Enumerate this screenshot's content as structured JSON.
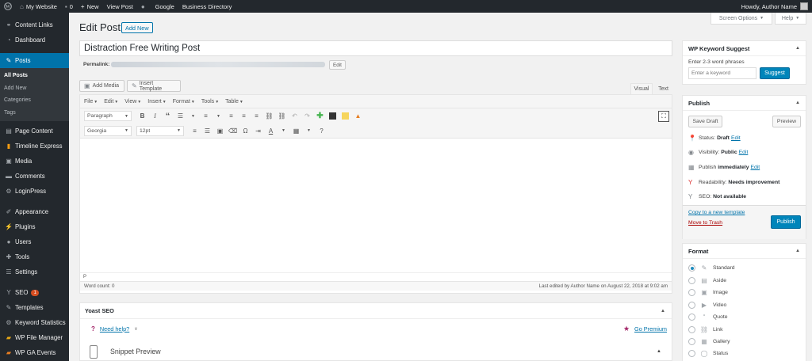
{
  "admin_bar": {
    "site_name": "My Website",
    "comments_count": "0",
    "new_label": "New",
    "view_post_label": "View Post",
    "google_label": "Google",
    "business_directory_label": "Business Directory",
    "howdy": "Howdy, Author Name"
  },
  "sidebar": {
    "items": [
      {
        "label": "Content Links",
        "icon": "link-icon"
      },
      {
        "label": "Dashboard",
        "icon": "dashboard-icon"
      },
      {
        "label": "Posts",
        "icon": "pushpin-icon"
      },
      {
        "label": "Page Content",
        "icon": "page-icon"
      },
      {
        "label": "Timeline Express",
        "icon": "timeline-icon"
      },
      {
        "label": "Media",
        "icon": "media-icon"
      },
      {
        "label": "Comments",
        "icon": "comment-icon"
      },
      {
        "label": "LoginPress",
        "icon": "login-icon"
      },
      {
        "label": "Appearance",
        "icon": "brush-icon"
      },
      {
        "label": "Plugins",
        "icon": "plugin-icon"
      },
      {
        "label": "Users",
        "icon": "user-icon"
      },
      {
        "label": "Tools",
        "icon": "wrench-icon"
      },
      {
        "label": "Settings",
        "icon": "settings-icon"
      },
      {
        "label": "SEO",
        "icon": "yoast-icon",
        "badge": "1"
      },
      {
        "label": "Templates",
        "icon": "template-icon"
      },
      {
        "label": "Keyword Statistics",
        "icon": "stats-icon"
      },
      {
        "label": "WP File Manager",
        "icon": "folder-icon"
      },
      {
        "label": "WP GA Events",
        "icon": "events-icon"
      }
    ],
    "posts_submenu": [
      "All Posts",
      "Add New",
      "Categories",
      "Tags"
    ]
  },
  "screen_options": "Screen Options",
  "help": "Help",
  "page": {
    "title": "Edit Post",
    "add_new": "Add New",
    "post_title": "Distraction Free Writing Post",
    "permalink_label": "Permalink:",
    "permalink_edit": "Edit"
  },
  "media_buttons": {
    "add_media": "Add Media",
    "insert_template": "Insert Template"
  },
  "editor": {
    "tab_visual": "Visual",
    "tab_text": "Text",
    "menus": [
      "File",
      "Edit",
      "View",
      "Insert",
      "Format",
      "Tools",
      "Table"
    ],
    "format_select": "Paragraph",
    "font_select": "Georgia",
    "size_select": "12pt",
    "path": "P",
    "word_count": "Word count: 0",
    "last_edited": "Last edited by Author Name on August 22, 2018 at 9:02 am"
  },
  "yoast": {
    "title": "Yoast SEO",
    "need_help": "Need help?",
    "go_premium": "Go Premium",
    "snippet_preview": "Snippet Preview"
  },
  "keyword_box": {
    "title": "WP Keyword Suggest",
    "label": "Enter 2-3 word phrases",
    "placeholder": "Enter a keyword",
    "button": "Suggest"
  },
  "publish_box": {
    "title": "Publish",
    "save_draft": "Save Draft",
    "preview": "Preview",
    "status_label": "Status:",
    "status_value": "Draft",
    "visibility_label": "Visibility:",
    "visibility_value": "Public",
    "publish_label": "Publish",
    "publish_value": "immediately",
    "readability_label": "Readability:",
    "readability_value": "Needs improvement",
    "seo_label": "SEO:",
    "seo_value": "Not available",
    "edit": "Edit",
    "copy_template": "Copy to a new template",
    "move_trash": "Move to Trash",
    "publish_button": "Publish"
  },
  "format_box": {
    "title": "Format",
    "options": [
      "Standard",
      "Aside",
      "Image",
      "Video",
      "Quote",
      "Link",
      "Gallery",
      "Status"
    ],
    "selected": "Standard"
  },
  "colors": {
    "admin_dark": "#23282d",
    "accent_blue": "#0073aa",
    "primary_button": "#0085ba",
    "trash_red": "#a00"
  }
}
